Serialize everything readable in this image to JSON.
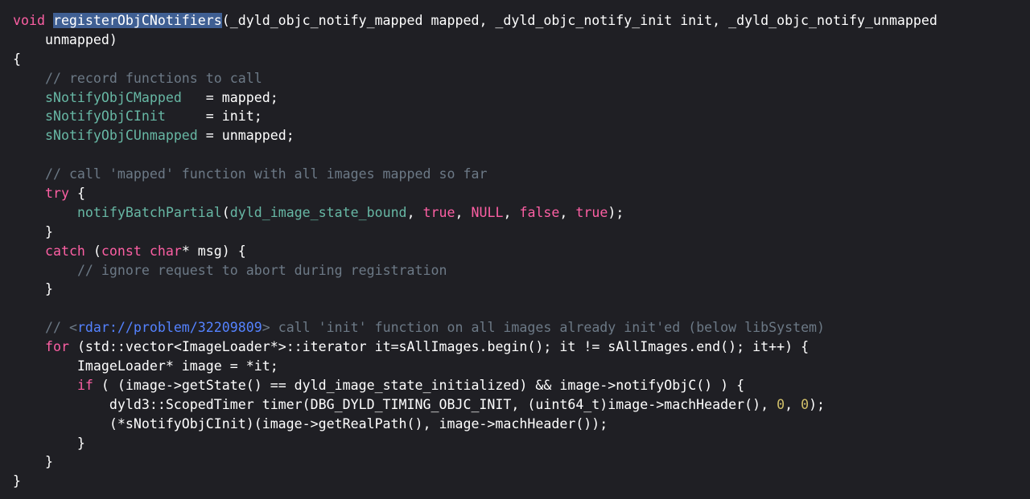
{
  "colors": {
    "background": "#1f1f24",
    "plain": "#ffffff",
    "keyword": "#fc5fa3",
    "function": "#67b7a4",
    "comment": "#6c7986",
    "number": "#d0bf69",
    "link": "#5482ff",
    "selection": "#3f5f93"
  },
  "code": {
    "lines": [
      [
        {
          "t": "kw",
          "v": "void "
        },
        {
          "t": "sel",
          "v": "registerObjCNotifiers"
        },
        {
          "t": "plain",
          "v": "(_dyld_objc_notify_mapped mapped, _dyld_objc_notify_init init, _dyld_objc_notify_unmapped"
        }
      ],
      [
        {
          "t": "plain",
          "v": "    unmapped)"
        }
      ],
      [
        {
          "t": "plain",
          "v": "{"
        }
      ],
      [
        {
          "t": "plain",
          "v": "    "
        },
        {
          "t": "comment",
          "v": "// record functions to call"
        }
      ],
      [
        {
          "t": "plain",
          "v": "    "
        },
        {
          "t": "func",
          "v": "sNotifyObjCMapped"
        },
        {
          "t": "plain",
          "v": "   = mapped;"
        }
      ],
      [
        {
          "t": "plain",
          "v": "    "
        },
        {
          "t": "func",
          "v": "sNotifyObjCInit"
        },
        {
          "t": "plain",
          "v": "     = init;"
        }
      ],
      [
        {
          "t": "plain",
          "v": "    "
        },
        {
          "t": "func",
          "v": "sNotifyObjCUnmapped"
        },
        {
          "t": "plain",
          "v": " = unmapped;"
        }
      ],
      [
        {
          "t": "plain",
          "v": ""
        }
      ],
      [
        {
          "t": "plain",
          "v": "    "
        },
        {
          "t": "comment",
          "v": "// call 'mapped' function with all images mapped so far"
        }
      ],
      [
        {
          "t": "plain",
          "v": "    "
        },
        {
          "t": "kw",
          "v": "try"
        },
        {
          "t": "plain",
          "v": " {"
        }
      ],
      [
        {
          "t": "plain",
          "v": "        "
        },
        {
          "t": "func",
          "v": "notifyBatchPartial"
        },
        {
          "t": "plain",
          "v": "("
        },
        {
          "t": "func",
          "v": "dyld_image_state_bound"
        },
        {
          "t": "plain",
          "v": ", "
        },
        {
          "t": "kw",
          "v": "true"
        },
        {
          "t": "plain",
          "v": ", "
        },
        {
          "t": "kw",
          "v": "NULL"
        },
        {
          "t": "plain",
          "v": ", "
        },
        {
          "t": "kw",
          "v": "false"
        },
        {
          "t": "plain",
          "v": ", "
        },
        {
          "t": "kw",
          "v": "true"
        },
        {
          "t": "plain",
          "v": ");"
        }
      ],
      [
        {
          "t": "plain",
          "v": "    }"
        }
      ],
      [
        {
          "t": "plain",
          "v": "    "
        },
        {
          "t": "kw",
          "v": "catch"
        },
        {
          "t": "plain",
          "v": " ("
        },
        {
          "t": "kw",
          "v": "const"
        },
        {
          "t": "plain",
          "v": " "
        },
        {
          "t": "kw",
          "v": "char"
        },
        {
          "t": "plain",
          "v": "* msg) {"
        }
      ],
      [
        {
          "t": "plain",
          "v": "        "
        },
        {
          "t": "comment",
          "v": "// ignore request to abort during registration"
        }
      ],
      [
        {
          "t": "plain",
          "v": "    }"
        }
      ],
      [
        {
          "t": "plain",
          "v": ""
        }
      ],
      [
        {
          "t": "plain",
          "v": "    "
        },
        {
          "t": "comment",
          "v": "// <"
        },
        {
          "t": "link",
          "v": "rdar://problem/32209809"
        },
        {
          "t": "comment",
          "v": "> call 'init' function on all images already init'ed (below libSystem)"
        }
      ],
      [
        {
          "t": "plain",
          "v": "    "
        },
        {
          "t": "kw",
          "v": "for"
        },
        {
          "t": "plain",
          "v": " (std::vector<ImageLoader*>::iterator it=sAllImages.begin(); it != sAllImages.end(); it++) {"
        }
      ],
      [
        {
          "t": "plain",
          "v": "        ImageLoader* image = *it;"
        }
      ],
      [
        {
          "t": "plain",
          "v": "        "
        },
        {
          "t": "kw",
          "v": "if"
        },
        {
          "t": "plain",
          "v": " ( (image->getState() == dyld_image_state_initialized) && image->notifyObjC() ) {"
        }
      ],
      [
        {
          "t": "plain",
          "v": "            dyld3::ScopedTimer timer(DBG_DYLD_TIMING_OBJC_INIT, (uint64_t)image->machHeader(), "
        },
        {
          "t": "num",
          "v": "0"
        },
        {
          "t": "plain",
          "v": ", "
        },
        {
          "t": "num",
          "v": "0"
        },
        {
          "t": "plain",
          "v": ");"
        }
      ],
      [
        {
          "t": "plain",
          "v": "            (*sNotifyObjCInit)(image->getRealPath(), image->machHeader());"
        }
      ],
      [
        {
          "t": "plain",
          "v": "        }"
        }
      ],
      [
        {
          "t": "plain",
          "v": "    }"
        }
      ],
      [
        {
          "t": "plain",
          "v": "}"
        }
      ]
    ]
  }
}
